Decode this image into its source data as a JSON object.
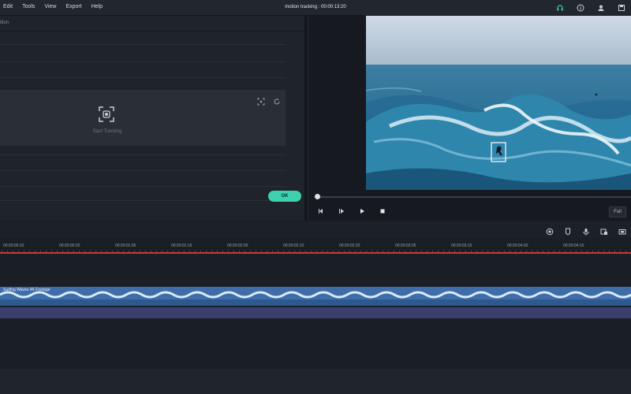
{
  "window": {
    "title": "motion tracking : 00:00:13:20"
  },
  "menu": [
    "Edit",
    "Tools",
    "View",
    "Export",
    "Help"
  ],
  "left_panel": {
    "header_label": "ition",
    "tracking_label": "Start Tracking",
    "ok_label": "OK"
  },
  "preview": {
    "full_label": "Full"
  },
  "timeline": {
    "ticks": [
      "00:00:00:10",
      "00:00:00:20",
      "00:00:01:05",
      "00:00:01:15",
      "00:00:02:00",
      "00:00:02:10",
      "00:00:02:20",
      "00:00:03:05",
      "00:00:03:15",
      "00:00:04:00",
      "00:00:04:10"
    ],
    "clip_name": "Surfing Waves 4K Footage"
  },
  "colors": {
    "accent": "#3fd0b0",
    "playhead": "#c53a3a",
    "video_track": "#4b76b5"
  }
}
